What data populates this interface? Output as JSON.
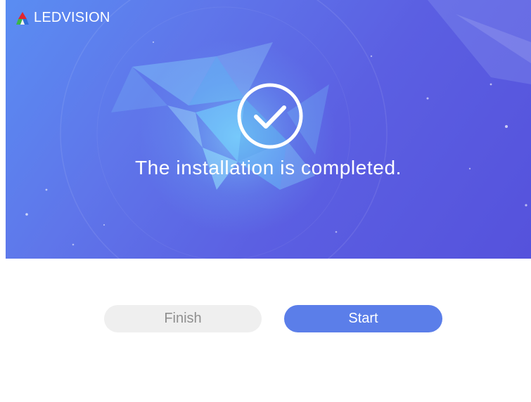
{
  "app": {
    "brand_name": "LEDVISION",
    "logo_icon": "ledvision-tri-color-logo-icon"
  },
  "banner": {
    "status_icon": "check-circle-icon",
    "message": "The installation is completed."
  },
  "actions": {
    "finish_label": "Finish",
    "start_label": "Start"
  },
  "colors": {
    "banner_gradient_start": "#5a8df2",
    "banner_gradient_end": "#5552dc",
    "start_button": "#5b7ee9",
    "finish_button": "#efefef",
    "finish_text": "#8f8f8f",
    "logo_red": "#e0262e",
    "logo_green": "#3ab54a",
    "logo_blue": "#2f6fd9"
  }
}
